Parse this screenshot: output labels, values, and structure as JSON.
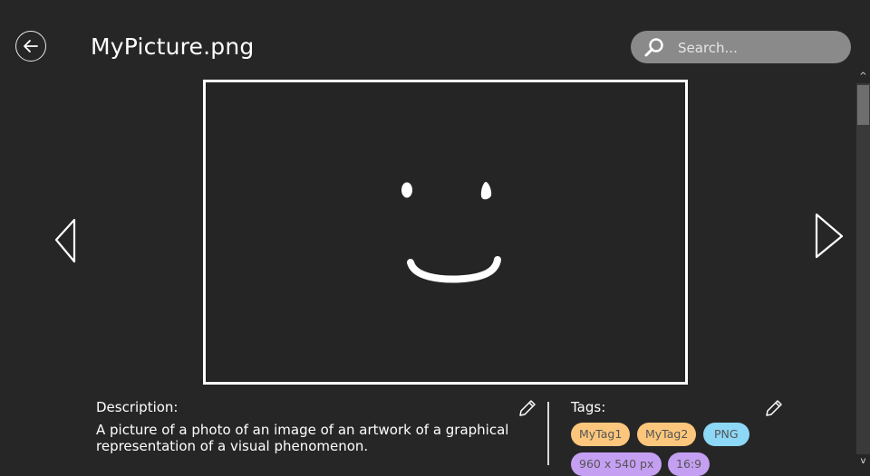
{
  "header": {
    "title": "MyPicture.png",
    "back_icon": "arrow-left-icon"
  },
  "search": {
    "placeholder": "Search...",
    "icon": "search-icon"
  },
  "navigation": {
    "prev_icon": "triangle-left-icon",
    "next_icon": "triangle-right-icon"
  },
  "description": {
    "label": "Description:",
    "text": "A picture of a photo of an image of an artwork of a graphical representation of a visual phenomenon.",
    "edit_icon": "pencil-icon"
  },
  "tags": {
    "label": "Tags:",
    "edit_icon": "pencil-icon",
    "items": [
      {
        "text": "MyTag1",
        "color": "#fcc77c"
      },
      {
        "text": "MyTag2",
        "color": "#fcc77c"
      },
      {
        "text": "PNG",
        "color": "#8dd7f7"
      },
      {
        "text": "960 x 540 px",
        "color": "#c59ff2"
      },
      {
        "text": "16:9",
        "color": "#c59ff2"
      }
    ]
  },
  "colors": {
    "background": "#262626",
    "search_bg": "#8a8a8a",
    "tag_orange": "#fcc77c",
    "tag_blue": "#8dd7f7",
    "tag_purple": "#c59ff2"
  }
}
